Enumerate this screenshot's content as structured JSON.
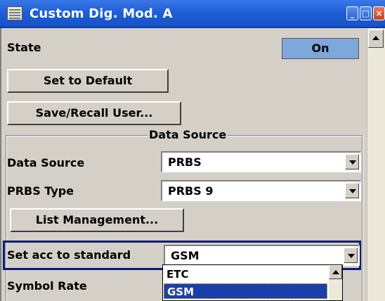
{
  "window": {
    "title": "Custom Dig. Mod. A",
    "icon": "app-menu-icon",
    "buttons": [
      "minimize-icon",
      "maximize-icon",
      "close-icon"
    ]
  },
  "state": {
    "label": "State",
    "value": "On"
  },
  "buttons": {
    "set_default": "Set to Default",
    "save_recall": "Save/Recall User...",
    "list_management": "List Management..."
  },
  "data_source_group": {
    "title": "Data Source",
    "data_source": {
      "label": "Data Source",
      "value": "PRBS"
    },
    "prbs_type": {
      "label": "PRBS Type",
      "value": "PRBS 9"
    }
  },
  "standard": {
    "label": "Set acc to standard",
    "value": "GSM",
    "options_visible": [
      "ETC",
      "GSM"
    ],
    "selected": "GSM"
  },
  "symbol_rate": {
    "label": "Symbol Rate"
  },
  "colors": {
    "titlebar": "#1f5fd6",
    "on_button": "#7fa7d9",
    "selected_item": "#1a3fa8",
    "highlight_border": "#0a1b78"
  }
}
